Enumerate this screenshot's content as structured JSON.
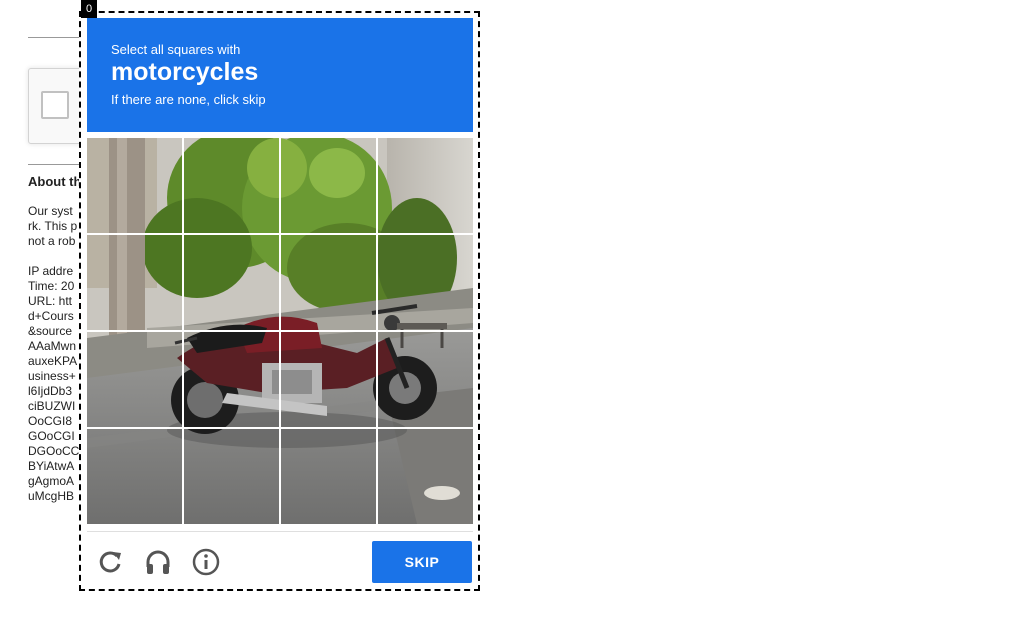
{
  "frame_counter": "0",
  "challenge": {
    "instruction_prefix": "Select all squares with",
    "target": "motorcycles",
    "instruction_suffix": "If there are none, click skip"
  },
  "footer": {
    "reload_icon": "reload-icon",
    "audio_icon": "headphones-icon",
    "info_icon": "info-icon",
    "skip_label": "SKIP"
  },
  "grid": {
    "rows": 4,
    "cols": 4
  },
  "background_page": {
    "heading": "About th",
    "lines": [
      "Our syst",
      "rk. This p",
      "not a rob",
      "",
      "IP addre",
      "Time: 20",
      "URL: htt",
      "d+Cours",
      "&source",
      "AAaMwn",
      "auxeKPA",
      "usiness+",
      "l6IjdDb3",
      "ciBUZWI",
      "OoCGI8",
      "GOoCGI",
      "DGOoCC",
      "BYiAtwA",
      "gAgmoA",
      "uMcgHB"
    ]
  },
  "colors": {
    "accent": "#1a73e8",
    "header_text": "#ffffff"
  }
}
